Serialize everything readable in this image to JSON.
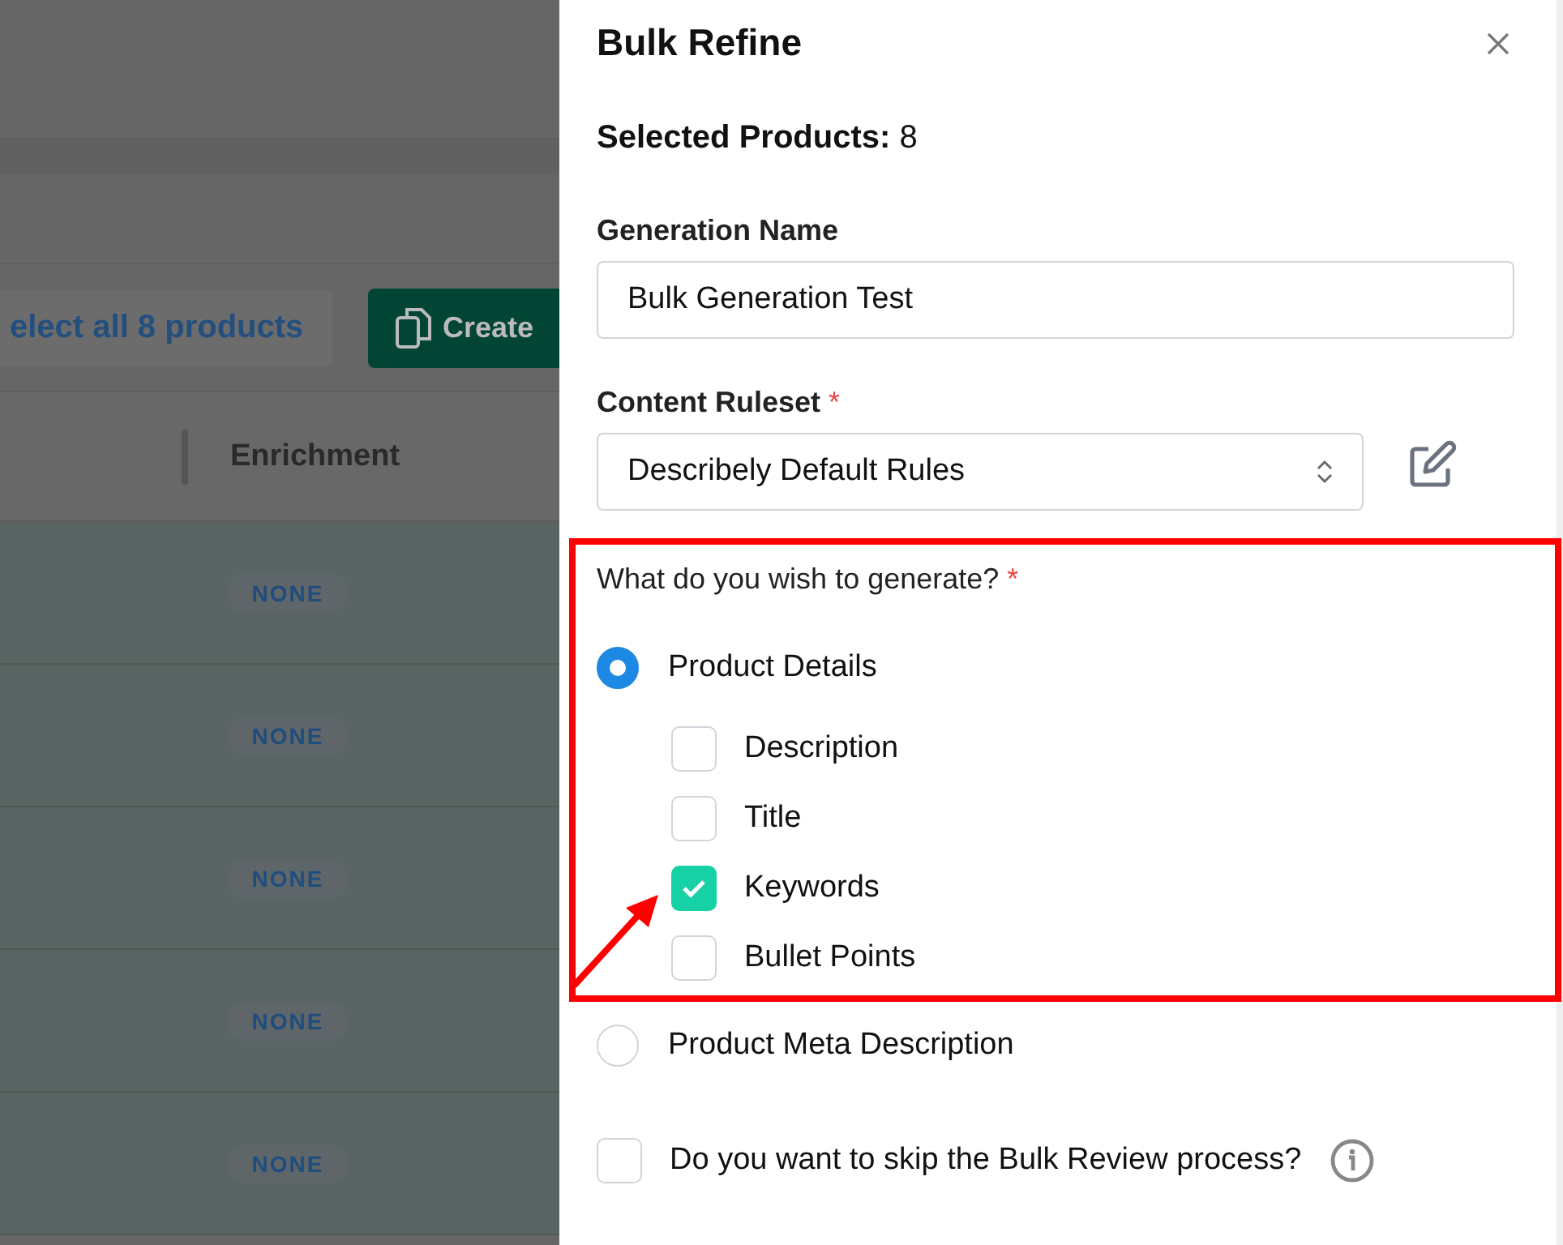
{
  "backdrop": {
    "select_all_button": "elect all 8 products",
    "create_button": "Create",
    "column_header": "Enrichment",
    "rows": [
      {
        "enrichment": "NONE"
      },
      {
        "enrichment": "NONE"
      },
      {
        "enrichment": "NONE"
      },
      {
        "enrichment": "NONE"
      },
      {
        "enrichment": "NONE"
      }
    ]
  },
  "panel": {
    "title": "Bulk Refine",
    "selected_label": "Selected Products:",
    "selected_value": "8",
    "generation_name": {
      "label": "Generation Name",
      "value": "Bulk Generation Test"
    },
    "content_ruleset": {
      "label": "Content Ruleset",
      "required_mark": "*",
      "value": "Describely Default Rules"
    },
    "generate": {
      "label": "What do you wish to generate?",
      "required_mark": "*",
      "options": [
        {
          "label": "Product Details",
          "selected": true,
          "children": [
            {
              "label": "Description",
              "checked": false
            },
            {
              "label": "Title",
              "checked": false
            },
            {
              "label": "Keywords",
              "checked": true
            },
            {
              "label": "Bullet Points",
              "checked": false
            }
          ]
        },
        {
          "label": "Product Meta Description",
          "selected": false
        }
      ]
    },
    "skip_review": {
      "label": "Do you want to skip the Bulk Review process?",
      "checked": false
    }
  }
}
